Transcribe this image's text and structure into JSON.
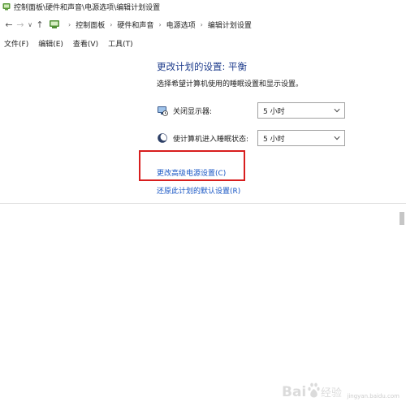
{
  "window": {
    "title": "控制面板\\硬件和声音\\电源选项\\编辑计划设置"
  },
  "nav": {
    "breadcrumbs": [
      "控制面板",
      "硬件和声音",
      "电源选项",
      "编辑计划设置"
    ]
  },
  "menu": {
    "items": [
      "文件(F)",
      "编辑(E)",
      "查看(V)",
      "工具(T)"
    ]
  },
  "content": {
    "heading": "更改计划的设置: 平衡",
    "subtitle": "选择希望计算机使用的睡眠设置和显示设置。",
    "settings": [
      {
        "label": "关闭显示器:",
        "value": "5 小时",
        "icon": "monitor-power-icon"
      },
      {
        "label": "使计算机进入睡眠状态:",
        "value": "5 小时",
        "icon": "moon-sleep-icon"
      }
    ],
    "links": {
      "advanced": "更改高级电源设置(C)",
      "restore": "还原此计划的默认设置(R)"
    }
  },
  "annotation": {
    "highlight_color": "#d81e1e"
  },
  "watermark": {
    "logo_text": "Bai 经验",
    "sub_text": "jingyan.baidu.com"
  },
  "colors": {
    "heading": "#1e3c8c",
    "link": "#1a57c5"
  }
}
